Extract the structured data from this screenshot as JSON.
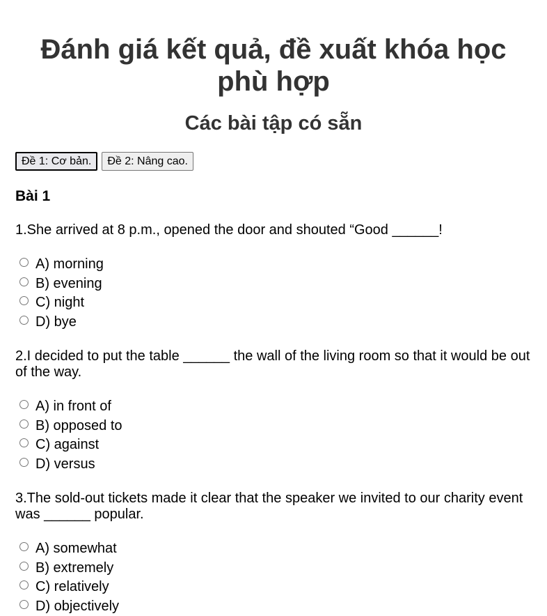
{
  "header": {
    "title": "Đánh giá kết quả, đề xuất khóa học phù hợp",
    "subtitle": "Các bài tập có sẵn"
  },
  "tabs": [
    {
      "label": "Đề 1: Cơ bản.",
      "active": true
    },
    {
      "label": "Đề 2: Nâng cao.",
      "active": false
    }
  ],
  "exercise": {
    "title": "Bài 1",
    "questions": [
      {
        "text": "1.She arrived at 8 p.m., opened the door and shouted “Good ______!",
        "options": [
          "A) morning",
          "B) evening",
          "C) night",
          "D) bye"
        ]
      },
      {
        "text": "2.I decided to put the table ______ the wall of the living room so that it would be out of the way.",
        "options": [
          "A) in front of",
          "B) opposed to",
          "C) against",
          "D) versus"
        ]
      },
      {
        "text": "3.The sold-out tickets made it clear that the speaker we invited to our charity event was ______ popular.",
        "options": [
          "A) somewhat",
          "B) extremely",
          "C) relatively",
          "D) objectively"
        ]
      }
    ]
  }
}
